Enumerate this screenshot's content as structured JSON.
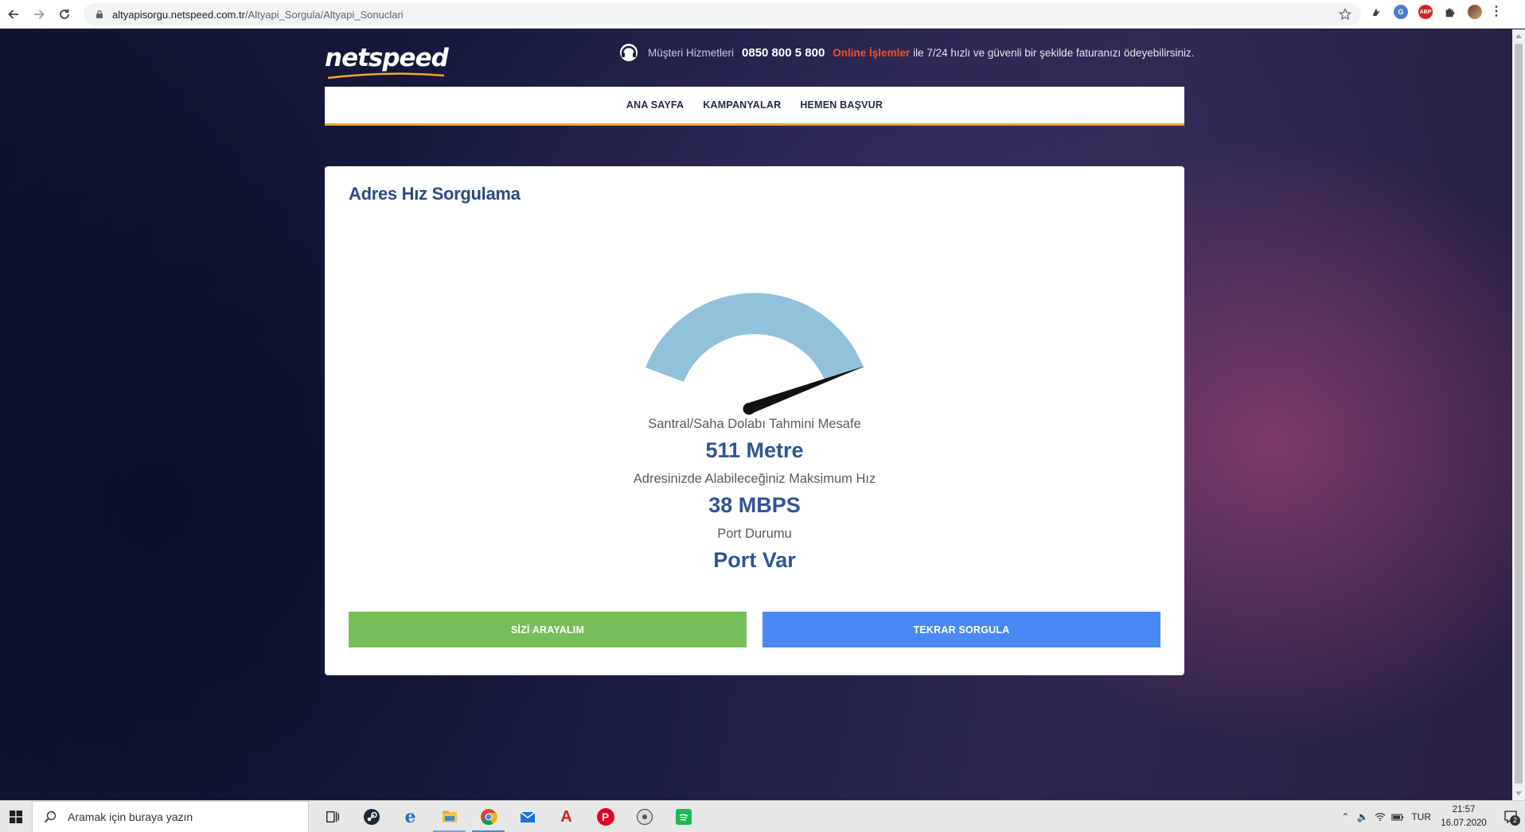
{
  "browser": {
    "url_host": "altyapisorgu.netspeed.com.tr",
    "url_path": "/Altyapi_Sorgula/Altyapi_Sonuclari",
    "ext_chat_label": "G",
    "ext_abp_label": "ABP"
  },
  "header": {
    "logo_text": "netspeed",
    "hotline_label": "Müşteri Hizmetleri",
    "hotline_number": "0850 800 5 800",
    "online_link": "Online İşlemler",
    "hotline_rest": "ile 7/24 hızlı ve güvenli bir şekilde faturanızı ödeyebilirsiniz."
  },
  "nav": {
    "items": [
      "ANA SAYFA",
      "KAMPANYALAR",
      "HEMEN BAŞVUR"
    ]
  },
  "card": {
    "title": "Adres Hız Sorgulama",
    "gauge_color": "#92c1dc",
    "gauge_needle_color": "#111111",
    "results": [
      {
        "label": "Santral/Saha Dolabı Tahmini Mesafe",
        "value": "511 Metre"
      },
      {
        "label": "Adresinizde Alabileceğiniz Maksimum Hız",
        "value": "38 MBPS"
      },
      {
        "label": "Port Durumu",
        "value": "Port Var"
      }
    ],
    "buttons": {
      "call_label": "SİZİ ARAYALIM",
      "requery_label": "TEKRAR SORGULA"
    }
  },
  "colors": {
    "brand_title": "#2b4a86",
    "value_blue": "#2f5597",
    "nav_underline": "#f2a81d",
    "online_orange": "#f4511e",
    "btn_green": "#77bd59",
    "btn_blue": "#4a89f3"
  },
  "taskbar": {
    "search_placeholder": "Aramak için buraya yazın",
    "apps": [
      "task-view-icon",
      "steam-icon",
      "edge-icon",
      "file-explorer-icon",
      "chrome-icon",
      "mail-icon",
      "acrobat-icon",
      "pinterest-icon",
      "media-player-icon",
      "spotify-icon"
    ],
    "acrobat_letter": "A",
    "pinterest_letter": "P",
    "edge_letter": "e",
    "language": "TUR",
    "time": "21:57",
    "date": "16.07.2020",
    "notification_count": "2"
  }
}
